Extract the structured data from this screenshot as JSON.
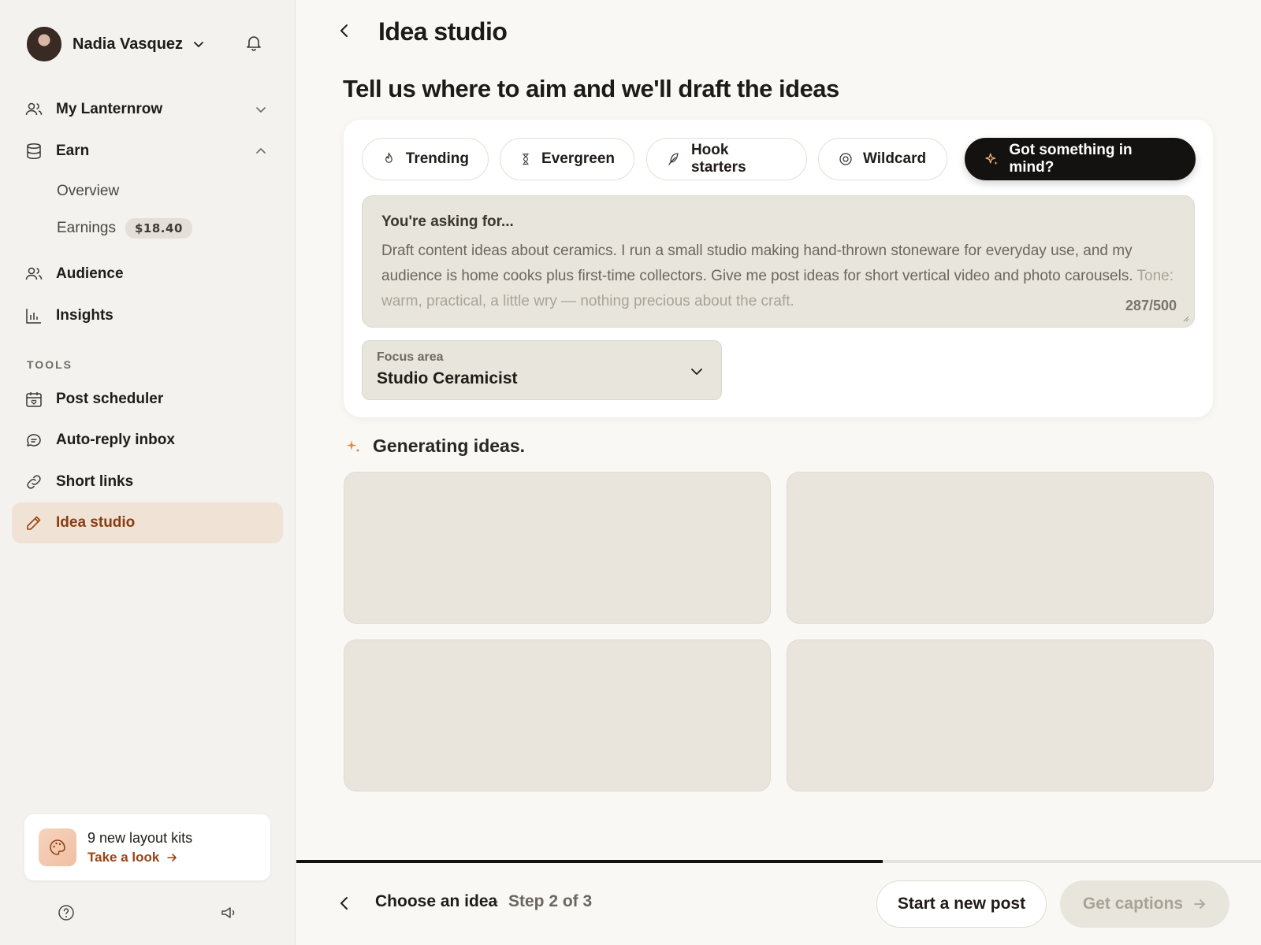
{
  "user": {
    "name": "Nadia Vasquez"
  },
  "sidebar": {
    "nav": [
      {
        "label": "My Lanternrow"
      },
      {
        "label": "Earn"
      }
    ],
    "earn_sub": [
      {
        "label": "Overview"
      },
      {
        "label": "Earnings",
        "badge": "$18.40"
      }
    ],
    "nav2": [
      {
        "label": "Audience"
      },
      {
        "label": "Insights"
      }
    ],
    "tools_label": "TOOLS",
    "tools": [
      {
        "label": "Post scheduler"
      },
      {
        "label": "Auto-reply inbox"
      },
      {
        "label": "Short links"
      },
      {
        "label": "Idea studio"
      }
    ],
    "promo": {
      "title": "9 new layout kits",
      "link": "Take a look"
    }
  },
  "main": {
    "title": "Idea studio",
    "headline": "Tell us where to aim and we'll draft the ideas",
    "chips": [
      "Trending",
      "Evergreen",
      "Hook starters",
      "Wildcard",
      "Got something in mind?"
    ],
    "prompt": {
      "label": "You're asking for...",
      "text": "Draft content ideas about ceramics. I run a small studio making hand-thrown stoneware for everyday use, and my audience is home cooks plus first-time collectors. Give me post ideas for short vertical video and photo carousels.",
      "text_fade": "Tone: warm, practical, a little wry — nothing precious about the craft.",
      "counter": "287/500"
    },
    "focus": {
      "label": "Focus area",
      "value": "Studio Ceramicist"
    },
    "generating": "Generating ideas."
  },
  "footer": {
    "step_title": "Choose an idea",
    "separator": "·",
    "step_count": "Step 2 of 3",
    "progress": 0.608,
    "new_post": "Start a new post",
    "captions": "Get captions"
  },
  "colors": {
    "accent": "#9b4413",
    "active_bg": "#f1e2d6",
    "primary_button": "#141210"
  }
}
